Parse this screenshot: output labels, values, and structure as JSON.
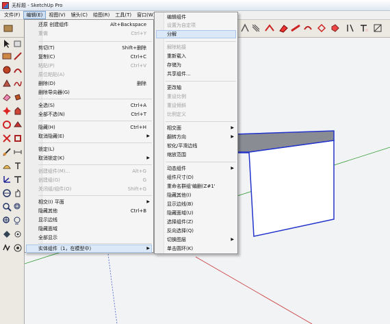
{
  "window": {
    "title": "无标题 - SketchUp Pro"
  },
  "menubar": [
    {
      "label": "文件(F)"
    },
    {
      "label": "编辑(E)"
    },
    {
      "label": "视图(V)"
    },
    {
      "label": "镜头(C)"
    },
    {
      "label": "绘图(R)"
    },
    {
      "label": "工具(T)"
    },
    {
      "label": "窗口(W)"
    }
  ],
  "edit_menu": {
    "items": [
      {
        "label": "还原 创建组件",
        "shortcut": "Alt+Backspace",
        "disabled": false
      },
      {
        "label": "重做",
        "shortcut": "Ctrl+Y",
        "disabled": true
      },
      {
        "label": "剪切(T)",
        "shortcut": "Shift+删除",
        "disabled": false
      },
      {
        "label": "复制(C)",
        "shortcut": "Ctrl+C",
        "disabled": false
      },
      {
        "label": "粘贴(P)",
        "shortcut": "Ctrl+V",
        "disabled": true
      },
      {
        "label": "原位粘贴(A)",
        "shortcut": "",
        "disabled": true
      },
      {
        "label": "删除(D)",
        "shortcut": "删除",
        "disabled": false
      },
      {
        "label": "删除导向器(G)",
        "shortcut": "",
        "disabled": false
      },
      {
        "label": "全选(S)",
        "shortcut": "Ctrl+A",
        "disabled": false
      },
      {
        "label": "全部不选(N)",
        "shortcut": "Ctrl+T",
        "disabled": false
      },
      {
        "label": "隐藏(H)",
        "shortcut": "Ctrl+H",
        "disabled": false
      },
      {
        "label": "取消隐藏(E)",
        "shortcut": "",
        "disabled": false,
        "submenu": true
      },
      {
        "label": "锁定(L)",
        "shortcut": "",
        "disabled": false
      },
      {
        "label": "取消锁定(K)",
        "shortcut": "",
        "disabled": false,
        "submenu": true
      },
      {
        "label": "创建组件(M)...",
        "shortcut": "Alt+G",
        "disabled": true
      },
      {
        "label": "创建组(G)",
        "shortcut": "G",
        "disabled": true
      },
      {
        "label": "关闭组/组件(O)",
        "shortcut": "Shift+G",
        "disabled": true
      },
      {
        "label": "相交(I) 平面",
        "shortcut": "",
        "disabled": false,
        "submenu": true
      },
      {
        "label": "隐藏其他",
        "shortcut": "Ctrl+B",
        "disabled": false
      },
      {
        "label": "显示边线",
        "shortcut": "",
        "disabled": false
      },
      {
        "label": "隐藏面域",
        "shortcut": "",
        "disabled": false
      },
      {
        "label": "全部显示",
        "shortcut": "",
        "disabled": false
      },
      {
        "label": "实体组件（1，在模型中）",
        "shortcut": "",
        "disabled": false,
        "submenu": true,
        "highlighted": true
      }
    ]
  },
  "component_menu": {
    "items": [
      {
        "label": "编辑组件",
        "disabled": false
      },
      {
        "label": "设置为自定项",
        "disabled": true
      },
      {
        "label": "分解",
        "disabled": false,
        "highlighted": true
      },
      {
        "label": "解除粘接",
        "disabled": true
      },
      {
        "label": "重新载入",
        "disabled": false
      },
      {
        "label": "存储为",
        "disabled": false
      },
      {
        "label": "共享组件...",
        "disabled": false
      },
      {
        "label": "更改轴",
        "disabled": false
      },
      {
        "label": "重设比例",
        "disabled": true
      },
      {
        "label": "重设倾斜",
        "disabled": true
      },
      {
        "label": "比例定义",
        "disabled": true
      },
      {
        "label": "相交面",
        "disabled": false,
        "submenu": true
      },
      {
        "label": "翻转方向",
        "disabled": false,
        "submenu": true
      },
      {
        "label": "软化/平滑边线",
        "disabled": false
      },
      {
        "label": "缩放范围",
        "disabled": false
      },
      {
        "label": "动态组件",
        "disabled": false,
        "submenu": true
      },
      {
        "label": "组件尺寸(D)",
        "disabled": false
      },
      {
        "label": "重命名群组'编删(Z#1'",
        "disabled": false
      },
      {
        "label": "隐藏其他(I)",
        "disabled": false
      },
      {
        "label": "显示边线(B)",
        "disabled": false
      },
      {
        "label": "隐藏面域(U)",
        "disabled": false
      },
      {
        "label": "选择组件(Z)",
        "disabled": false
      },
      {
        "label": "反向选择(Q)",
        "disabled": false
      },
      {
        "label": "切换图层",
        "disabled": false,
        "submenu": true
      },
      {
        "label": "单击圆环(K)",
        "disabled": false
      }
    ]
  },
  "colors": {
    "axis_green": "#2f9a2f",
    "axis_red": "#c83232",
    "axis_blue": "#3c5ac8",
    "edge_blue": "#2233cc",
    "face_top": "#8a8c94",
    "face_front": "#ffffff",
    "menu_highlight": "#dbe8f7"
  }
}
